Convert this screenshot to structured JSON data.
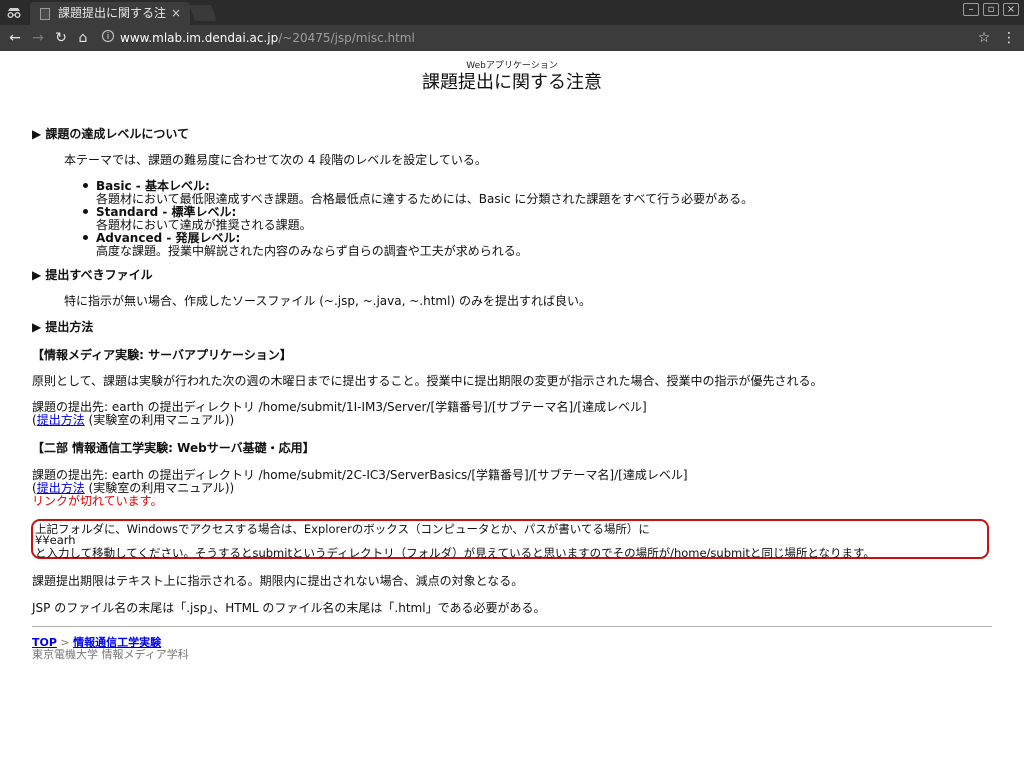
{
  "browser": {
    "tab_title": "課題提出に関する注",
    "tab_close": "×",
    "url_host": "www.mlab.im.dendai.ac.jp",
    "url_path": "/~20475/jsp/misc.html",
    "nav": {
      "back": "←",
      "forward": "→",
      "reload": "↻",
      "home": "⌂",
      "star": "☆",
      "menu": "⋮",
      "info": "i"
    },
    "window": {
      "minimize": "–",
      "maximize": "▫",
      "close": "×"
    }
  },
  "header": {
    "subtitle": "Webアプリケーション",
    "title": "課題提出に関する注意"
  },
  "section1": {
    "heading": "▶ 課題の達成レベルについて",
    "intro": "本テーマでは、課題の難易度に合わせて次の 4 段階のレベルを設定している。",
    "levels": [
      {
        "name": "Basic - 基本レベル:",
        "desc": "各題材において最低限達成すべき課題。合格最低点に達するためには、Basic に分類された課題をすべて行う必要がある。"
      },
      {
        "name": "Standard - 標準レベル:",
        "desc": "各題材において達成が推奨される課題。"
      },
      {
        "name": "Advanced - 発展レベル:",
        "desc": "高度な課題。授業中解説された内容のみならず自らの調査や工夫が求められる。"
      }
    ]
  },
  "section2": {
    "heading": "▶ 提出すべきファイル",
    "text": "特に指示が無い場合、作成したソースファイル (~.jsp, ~.java, ~.html) のみを提出すれば良い。"
  },
  "section3": {
    "heading": "▶ 提出方法",
    "media": {
      "heading": "【情報メディア実験: サーバアプリケーション】",
      "rule": "原則として、課題は実験が行われた次の週の木曜日までに提出すること。授業中に提出期限の変更が指示された場合、授業中の指示が優先される。",
      "dest": "課題の提出先: earth の提出ディレクトリ /home/submit/1I-IM3/Server/[学籍番号]/[サブテーマ名]/[達成レベル]",
      "paren_open": "(",
      "link": "提出方法",
      "paren_rest": " (実験室の利用マニュアル))"
    },
    "comm": {
      "heading": "【二部 情報通信工学実験: Webサーバ基礎・応用】",
      "dest": "課題の提出先: earth の提出ディレクトリ /home/submit/2C-IC3/ServerBasics/[学籍番号]/[サブテーマ名]/[達成レベル]",
      "paren_open": "(",
      "link": "提出方法",
      "paren_rest": " (実験室の利用マニュアル))",
      "broken": "リンクが切れています。"
    },
    "notice": {
      "line1": "上記フォルダに、Windowsでアクセスする場合は、Explorerのボックス（コンピュータとか、パスが書いてる場所）に",
      "line2": "¥¥earh",
      "line3": "と入力して移動してください。そうするとsubmitというディレクトリ（フォルダ）が見えていると思いますのでその場所が/home/submitと同じ場所となります。"
    },
    "deadline": "課題提出期限はテキスト上に指示される。期限内に提出されない場合、減点の対象となる。",
    "filename": "JSP のファイル名の末尾は「.jsp」、HTML のファイル名の末尾は「.html」である必要がある。"
  },
  "footer": {
    "top": "TOP",
    "sep": " > ",
    "course": "情報通信工学実験",
    "org": "東京電機大学 情報メディア学科"
  }
}
